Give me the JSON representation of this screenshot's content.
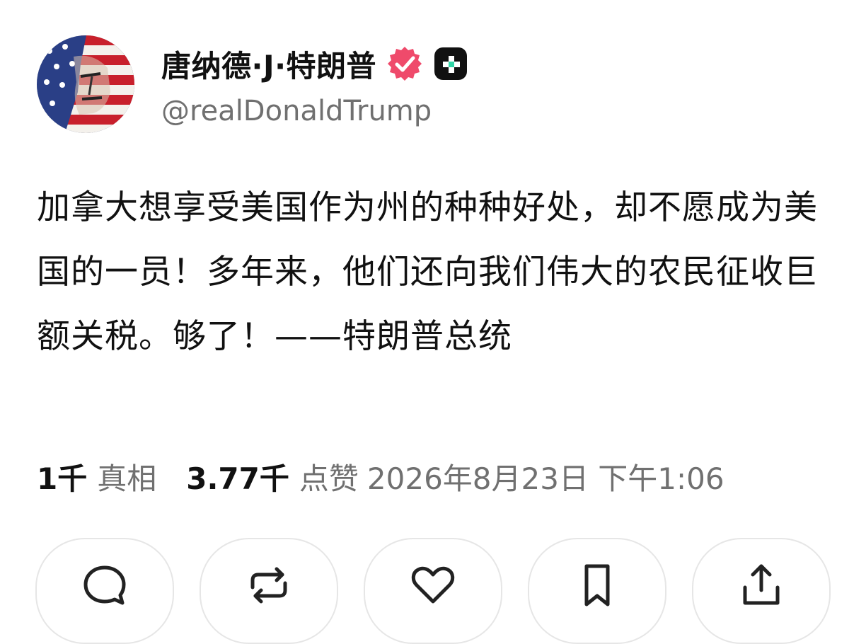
{
  "author": {
    "display_name": "唐纳德·J·特朗普",
    "handle": "@realDonaldTrump",
    "verified_color": "#ef4a6b"
  },
  "post": {
    "text": "加拿大想享受美国作为州的种种好处，却不愿成为美国的一员！多年来，他们还向我们伟大的农民征收巨额关税。够了！——特朗普总统"
  },
  "stats": {
    "retruths_count": "1千",
    "retruths_label": "真相",
    "likes_count": "3.77千",
    "likes_label": "点赞",
    "timestamp": "2026年8月23日 下午1:06"
  },
  "actions": [
    {
      "icon": "reply-icon"
    },
    {
      "icon": "repost-icon"
    },
    {
      "icon": "like-icon"
    },
    {
      "icon": "bookmark-icon"
    },
    {
      "icon": "share-icon"
    }
  ]
}
